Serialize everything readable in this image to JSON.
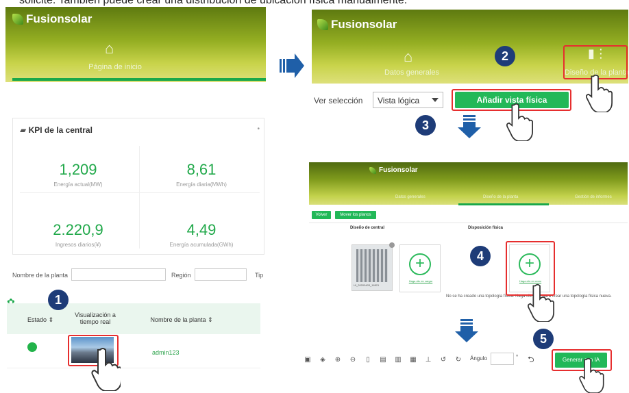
{
  "intro_text": "solicite. También puede crear una distribución de ubicación física manualmente.",
  "panel1": {
    "brand": "Fusionsolar",
    "nav_label": "Página de inicio",
    "kpi_title": "KPI de la central",
    "kpi_more": "•",
    "kpis": [
      {
        "value": "1,209",
        "label": "Energía actual(MW)"
      },
      {
        "value": "8,61",
        "label": "Energía diaria(MWh)"
      },
      {
        "value": "2.220,9",
        "label": "Ingresos diarios(¥)"
      },
      {
        "value": "4,49",
        "label": "Energía acumulada(GWh)"
      }
    ],
    "filters": {
      "plant_name_label": "Nombre de la planta",
      "region_label": "Región",
      "type_label": "Tip"
    },
    "table": {
      "headers": [
        "Estado ⇕",
        "Visualización a tiempo real",
        "Nombre de la planta ⇕"
      ],
      "row": {
        "plant_name": "admin123"
      }
    }
  },
  "panel2": {
    "brand": "Fusionsolar",
    "nav_left": "Datos generales",
    "nav_right": "Diseño de la planta",
    "view_label": "Ver selección",
    "view_value": "Vista lógica",
    "add_button": "Añadir vista física"
  },
  "panel3": {
    "brand": "Fusionsolar",
    "nav": [
      "Datos generales",
      "Diseño de la planta",
      "Gestión de informes"
    ],
    "btn_back": "Volver",
    "btn_move": "Mover los planos",
    "design_label": "Diseño de central",
    "layout_label": "Disposición física",
    "design_caption": "UI_20200403_16521",
    "add_left_text": "Haga clic en cargar",
    "add_right_text": "Haga clic en crear",
    "no_topology": "No se ha creado una topología física. Haga clic en + para crear una topología física nueva."
  },
  "toolbar": {
    "angle_label": "Ángulo",
    "angle_unit": "°",
    "generate_button": "Generar con IA"
  },
  "steps": [
    "1",
    "2",
    "3",
    "4",
    "5"
  ],
  "colors": {
    "brand_green": "#22b858",
    "badge_blue": "#1e3c78",
    "highlight_red": "#e62e2e",
    "arrow_blue": "#1f5fa8"
  }
}
